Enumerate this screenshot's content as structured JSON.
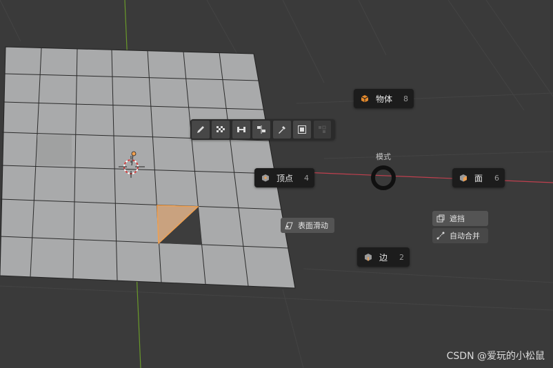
{
  "pie_menu": {
    "title": "模式",
    "items": [
      {
        "label": "物体",
        "key": "8",
        "icon": "object-cube-icon"
      },
      {
        "label": "顶点",
        "key": "4",
        "icon": "vertex-cube-icon"
      },
      {
        "label": "面",
        "key": "6",
        "icon": "face-cube-icon"
      },
      {
        "label": "边",
        "key": "2",
        "icon": "edge-cube-icon"
      }
    ],
    "extra": {
      "surface_slide": "表面滑动",
      "occlude": "遮挡",
      "auto_merge": "自动合并"
    }
  },
  "toolbar": {
    "icons": [
      "pencil-icon",
      "checker-icon",
      "weight-icon",
      "mirror-icon",
      "eyedropper-icon",
      "select-box-icon",
      "disabled-icon"
    ]
  },
  "watermark": "CSDN @爱玩的小松鼠",
  "colors": {
    "background": "#3a3a3a",
    "mesh_face": "#a9aaab",
    "selection_orange": "#f0a050",
    "x_axis": "#c1404f",
    "y_axis": "#6a9a2a"
  }
}
